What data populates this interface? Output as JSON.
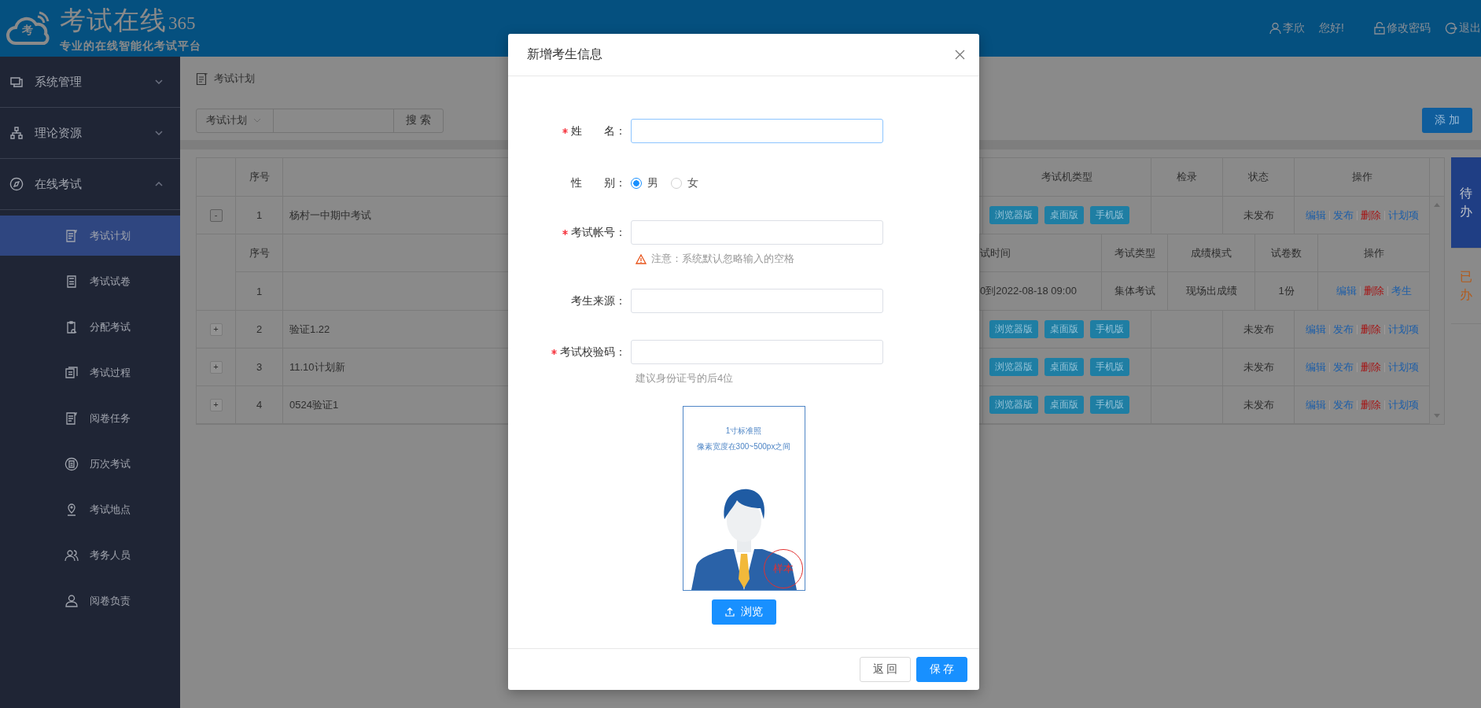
{
  "header": {
    "logo_badge": "考",
    "logo_title": "考试在线",
    "logo_suffix": "365",
    "subtitle": "专业的在线智能化考试平台",
    "user": "李欣",
    "greeting": "您好!",
    "change_password": "修改密码",
    "logout": "退出"
  },
  "sidebar": {
    "groups": [
      {
        "label": "系统管理",
        "expanded": false
      },
      {
        "label": "理论资源",
        "expanded": false
      },
      {
        "label": "在线考试",
        "expanded": true,
        "children": [
          {
            "label": "考试计划",
            "selected": true
          },
          {
            "label": "考试试卷",
            "selected": false
          },
          {
            "label": "分配考试",
            "selected": false
          },
          {
            "label": "考试过程",
            "selected": false
          },
          {
            "label": "阅卷任务",
            "selected": false
          },
          {
            "label": "历次考试",
            "selected": false
          },
          {
            "label": "考试地点",
            "selected": false
          },
          {
            "label": "考务人员",
            "selected": false
          },
          {
            "label": "阅卷负责",
            "selected": false
          }
        ]
      }
    ]
  },
  "breadcrumb": "考试计划",
  "search": {
    "category": "考试计划",
    "button": "搜 索"
  },
  "add_button": "添 加",
  "table": {
    "columns": [
      "序号",
      "考试机类型",
      "检录",
      "状态",
      "操作"
    ],
    "rows": [
      {
        "toggle": "-",
        "expanded": true,
        "index": "1",
        "name": "杨村一中期中考试",
        "clients": [
          "浏览器版",
          "桌面版",
          "手机版"
        ],
        "status": "未发布",
        "actions": [
          {
            "label": "编辑",
            "kind": "link"
          },
          {
            "label": "发布",
            "kind": "link"
          },
          {
            "label": "删除",
            "kind": "danger"
          },
          {
            "label": "计划项",
            "kind": "link"
          }
        ],
        "sub_table": {
          "columns": [
            "序号",
            "试时间",
            "考试类型",
            "成绩模式",
            "试卷数",
            "操作"
          ],
          "rows": [
            {
              "index": "1",
              "time": "0到2022-08-18 09:00",
              "type": "集体考试",
              "score_mode": "现场出成绩",
              "papers": "1份",
              "actions": [
                {
                  "label": "编辑",
                  "kind": "link"
                },
                {
                  "label": "删除",
                  "kind": "danger"
                },
                {
                  "label": "考生",
                  "kind": "link"
                }
              ]
            }
          ]
        }
      },
      {
        "toggle": "+",
        "expanded": false,
        "index": "2",
        "name": "验证1.22",
        "clients": [
          "浏览器版",
          "桌面版",
          "手机版"
        ],
        "status": "未发布",
        "actions": [
          {
            "label": "编辑",
            "kind": "link"
          },
          {
            "label": "发布",
            "kind": "link"
          },
          {
            "label": "删除",
            "kind": "danger"
          },
          {
            "label": "计划项",
            "kind": "link"
          }
        ]
      },
      {
        "toggle": "+",
        "expanded": false,
        "index": "3",
        "name": "11.10计划新",
        "clients": [
          "浏览器版",
          "桌面版",
          "手机版"
        ],
        "status": "未发布",
        "actions": [
          {
            "label": "编辑",
            "kind": "link"
          },
          {
            "label": "发布",
            "kind": "link"
          },
          {
            "label": "删除",
            "kind": "danger"
          },
          {
            "label": "计划项",
            "kind": "link"
          }
        ]
      },
      {
        "toggle": "+",
        "expanded": false,
        "index": "4",
        "name": "0524验证1",
        "clients": [
          "浏览器版",
          "桌面版",
          "手机版"
        ],
        "status": "未发布",
        "actions": [
          {
            "label": "编辑",
            "kind": "link"
          },
          {
            "label": "发布",
            "kind": "link"
          },
          {
            "label": "删除",
            "kind": "danger"
          },
          {
            "label": "计划项",
            "kind": "link"
          }
        ]
      }
    ]
  },
  "side_tabs": [
    {
      "label": "待办",
      "selected": true
    },
    {
      "label": "已办",
      "selected": false
    }
  ],
  "dialog": {
    "title": "新增考生信息",
    "fields": [
      {
        "kind": "text",
        "label": "姓　　名：",
        "required": true,
        "focused": true
      },
      {
        "kind": "radio",
        "label": "性　　别：",
        "required": false,
        "options": [
          {
            "label": "男",
            "selected": true
          },
          {
            "label": "女",
            "selected": false
          }
        ]
      },
      {
        "kind": "text",
        "label": "考试帐号：",
        "required": true,
        "focused": false,
        "warning": "注意：系统默认忽略输入的空格"
      },
      {
        "kind": "text",
        "label": "考生来源：",
        "required": false,
        "focused": false
      },
      {
        "kind": "text",
        "label": "考试校验码：",
        "required": true,
        "focused": false,
        "hint": "建议身份证号的后4位"
      }
    ],
    "photo": {
      "caption": "1寸标准照",
      "note": "像素宽度在300~500px之间",
      "stamp": "样本"
    },
    "upload_button": "浏览",
    "buttons": [
      {
        "label": "返 回",
        "kind": "default"
      },
      {
        "label": "保 存",
        "kind": "primary"
      }
    ]
  }
}
